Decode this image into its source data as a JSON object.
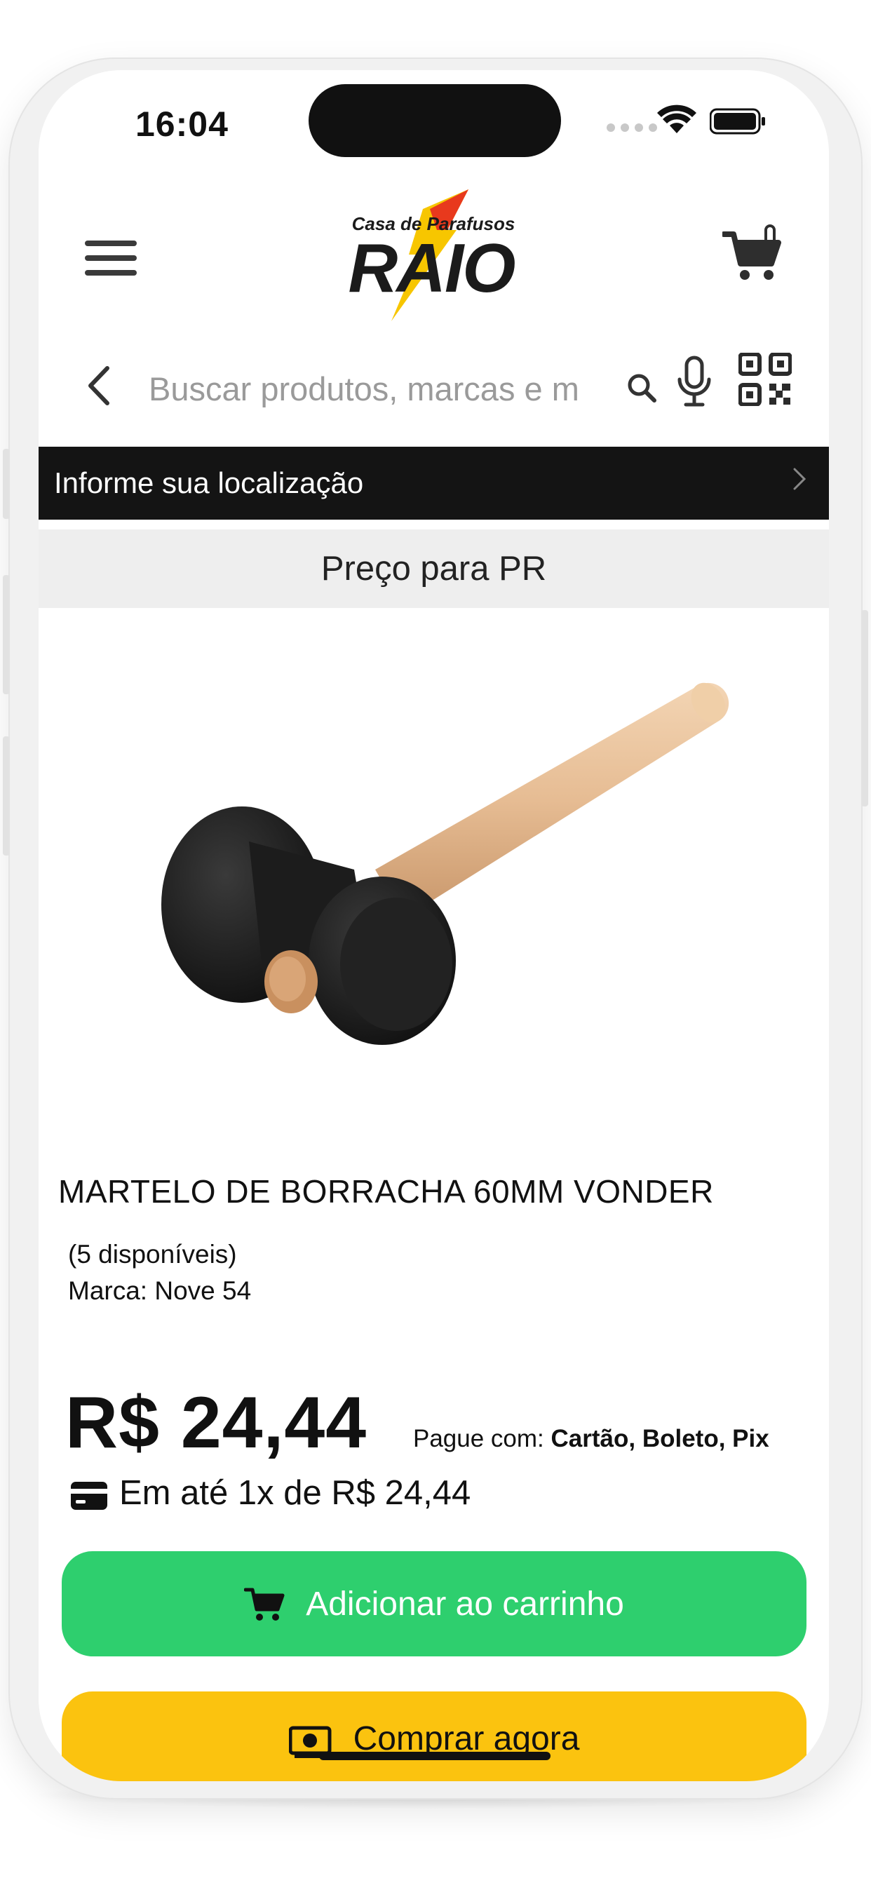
{
  "status_bar": {
    "time": "16:04"
  },
  "header": {
    "logo_text_top": "Casa de Parafusos",
    "logo_text_main": "RAIO"
  },
  "search": {
    "placeholder": "Buscar produtos, marcas e m"
  },
  "location": {
    "label": "Informe sua localização"
  },
  "region": {
    "label": "Preço para PR"
  },
  "product": {
    "title": "MARTELO DE BORRACHA 60MM VONDER",
    "stock": "(5 disponíveis)",
    "brand": "Marca: Nove 54",
    "price": "R$ 24,44",
    "pay_with_label": "Pague com:",
    "pay_methods": "Cartão, Boleto, Pix",
    "installments": "Em até 1x de R$ 24,44"
  },
  "actions": {
    "add_to_cart": "Adicionar ao carrinho",
    "buy_now": "Comprar agora"
  },
  "colors": {
    "location_bar": "#141414",
    "add_button": "#2ecf6e",
    "buy_button": "#fbc30f",
    "logo_red": "#e8391d",
    "logo_yellow": "#f7c600"
  },
  "icons": [
    "menu-icon",
    "cart-icon",
    "back-chevron-icon",
    "search-icon",
    "microphone-icon",
    "qr-code-icon",
    "chevron-right-icon",
    "credit-card-icon",
    "money-icon",
    "wifi-icon",
    "battery-icon"
  ]
}
